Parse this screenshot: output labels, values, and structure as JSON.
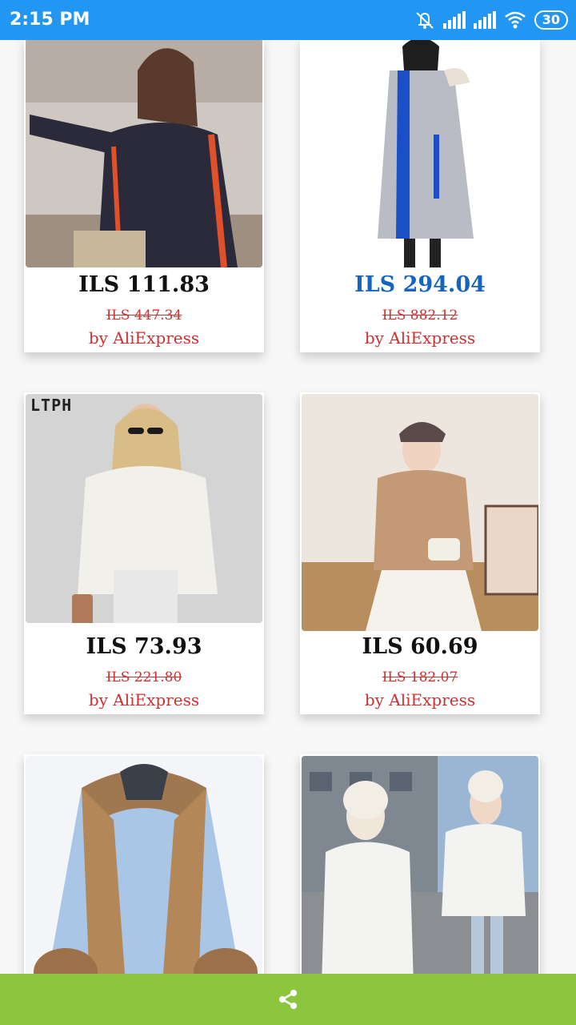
{
  "status_bar": {
    "time": "2:15 PM",
    "battery": "30",
    "icons": [
      "mute-icon",
      "signal-icon",
      "signal-icon",
      "wifi-icon",
      "battery-icon"
    ]
  },
  "products": [
    {
      "price": "ILS 111.83",
      "old_price": "ILS 447.34",
      "seller": "by AliExpress",
      "image": "patterned-track-jacket"
    },
    {
      "price": "ILS 294.04",
      "old_price": "ILS 882.12",
      "seller": "by AliExpress",
      "image": "silver-long-puffer-coat"
    },
    {
      "price": "ILS 73.93",
      "old_price": "ILS 221.80",
      "seller": "by AliExpress",
      "image": "white-fleece-jacket",
      "image_text": "LTPH"
    },
    {
      "price": "ILS 60.69",
      "old_price": "ILS 182.07",
      "seller": "by AliExpress",
      "image": "beige-wool-jacket"
    },
    {
      "image": "fur-trim-denim-parka"
    },
    {
      "image": "white-puffer-jackets"
    }
  ],
  "bottom_bar": {
    "icon": "share-icon"
  },
  "colors": {
    "status_bar": "#2196f3",
    "bottom_bar": "#8cc63f",
    "highlight_price": "#1565c0",
    "old_price": "#d32f2f",
    "seller": "#d32f2f"
  }
}
